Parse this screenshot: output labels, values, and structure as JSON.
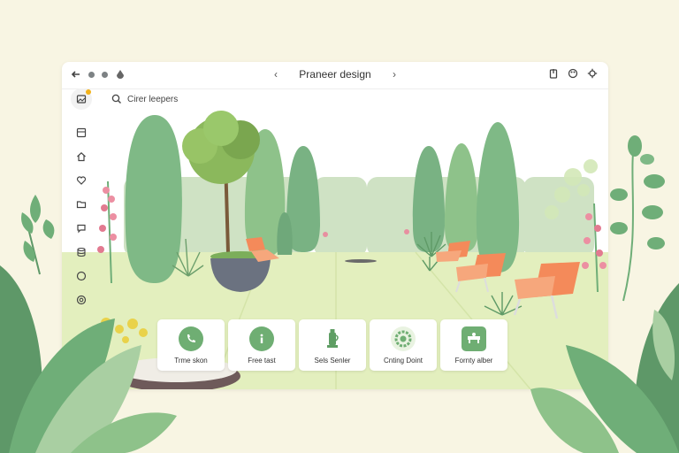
{
  "window": {
    "title": "Praneer design",
    "back_icon": "arrow-left-icon",
    "prev_icon": "chevron-left-icon",
    "next_icon": "chevron-right-icon"
  },
  "search": {
    "label": "Cirer leepers"
  },
  "sidebar": {
    "items": [
      {
        "icon": "image-icon"
      },
      {
        "icon": "layout-icon"
      },
      {
        "icon": "home-icon"
      },
      {
        "icon": "heart-icon"
      },
      {
        "icon": "folder-icon"
      },
      {
        "icon": "chat-icon"
      },
      {
        "icon": "database-icon"
      },
      {
        "icon": "circle-icon"
      },
      {
        "icon": "settings-icon"
      }
    ]
  },
  "cards": [
    {
      "label": "Trme skon",
      "icon": "phone-icon"
    },
    {
      "label": "Free tast",
      "icon": "info-icon"
    },
    {
      "label": "Sels Senler",
      "icon": "lantern-icon"
    },
    {
      "label": "Cnting Doint",
      "icon": "wreath-icon"
    },
    {
      "label": "Fornty alber",
      "icon": "bench-icon"
    }
  ],
  "colors": {
    "background": "#f8f5e3",
    "lawn": "#e3efbe",
    "accent_green": "#6fae73",
    "chair_orange": "#f48a5a"
  }
}
